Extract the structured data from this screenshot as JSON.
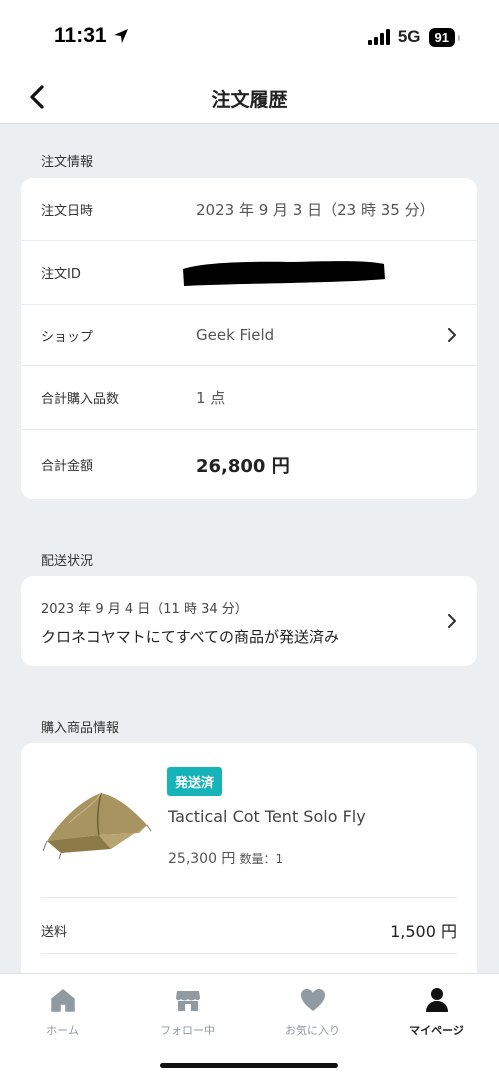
{
  "status_bar": {
    "time": "11:31",
    "network": "5G",
    "battery": "91"
  },
  "header": {
    "title": "注文履歴"
  },
  "order_info": {
    "section_label": "注文情報",
    "rows": {
      "date_label": "注文日時",
      "date_value": "2023 年 9 月 3 日（23 時 35 分）",
      "id_label": "注文ID",
      "shop_label": "ショップ",
      "shop_value": "Geek Field",
      "count_label": "合計購入品数",
      "count_value": "1 点",
      "total_label": "合計金額",
      "total_value": "26,800 円"
    }
  },
  "shipping": {
    "section_label": "配送状況",
    "date": "2023 年 9 月 4 日（11 時 34 分）",
    "status": "クロネコヤマトにてすべての商品が発送済み"
  },
  "products": {
    "section_label": "購入商品情報",
    "items": [
      {
        "badge": "発送済",
        "name": "Tactical Cot Tent Solo Fly",
        "price": "25,300 円",
        "quantity": "数量：1"
      }
    ],
    "shipping_fee_label": "送料",
    "shipping_fee_value": "1,500 円"
  },
  "tabbar": {
    "tabs": [
      {
        "label": "ホーム",
        "icon": "home-icon"
      },
      {
        "label": "フォロー中",
        "icon": "store-icon"
      },
      {
        "label": "お気に入り",
        "icon": "heart-icon"
      },
      {
        "label": "マイページ",
        "icon": "person-icon"
      }
    ],
    "active": "マイページ"
  },
  "colors": {
    "background": "#eceff1",
    "badge": "#16b3b8",
    "tab_inactive": "#8f9aa3",
    "tab_active": "#222222"
  }
}
